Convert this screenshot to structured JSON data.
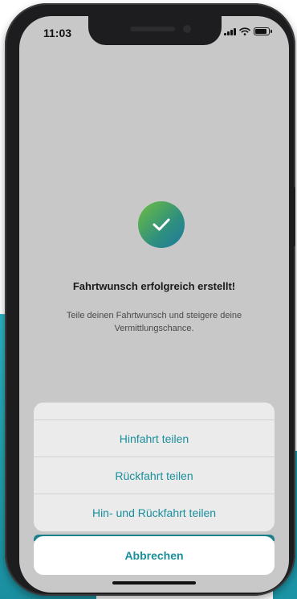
{
  "status_bar": {
    "time": "11:03",
    "icons": [
      "signal-icon",
      "wifi-icon",
      "battery-icon"
    ]
  },
  "confirmation": {
    "icon": "check-icon",
    "title": "Fahrtwunsch erfolgreich erstellt!",
    "subtitle": "Teile deinen Fahrtwunsch und steigere deine Vermittlungschance."
  },
  "action_sheet": {
    "options": [
      {
        "label": "Hinfahrt teilen"
      },
      {
        "label": "Rückfahrt teilen"
      },
      {
        "label": "Hin- und Rückfahrt teilen"
      }
    ],
    "cancel_label": "Abbrechen"
  },
  "colors": {
    "accent": "#1a8f9c",
    "success_gradient_start": "#6fbf3f",
    "success_gradient_end": "#1f7aa0",
    "overlay": "#c8c8c8"
  }
}
